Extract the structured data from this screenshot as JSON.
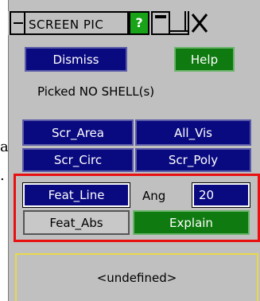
{
  "edge_text": [
    "a",
    "."
  ],
  "window": {
    "title": "SCREEN PIC",
    "help_icon_label": "?"
  },
  "buttons": {
    "dismiss": "Dismiss",
    "help": "Help",
    "scr_area": "Scr_Area",
    "all_vis": "All_Vis",
    "scr_circ": "Scr_Circ",
    "scr_poly": "Scr_Poly",
    "feat_line": "Feat_Line",
    "feat_abs": "Feat_Abs",
    "explain": "Explain"
  },
  "status": {
    "picked": "Picked NO SHELL(s)"
  },
  "angle": {
    "label": "Ang",
    "value": "20"
  },
  "selection_box": {
    "text": "<undefined>"
  },
  "colors": {
    "panel_bg": "#c0c0c0",
    "button_blue": "#0a0a80",
    "button_green": "#0f7a0f",
    "highlight_red": "#e81010",
    "undefined_border": "#e8d84a"
  }
}
